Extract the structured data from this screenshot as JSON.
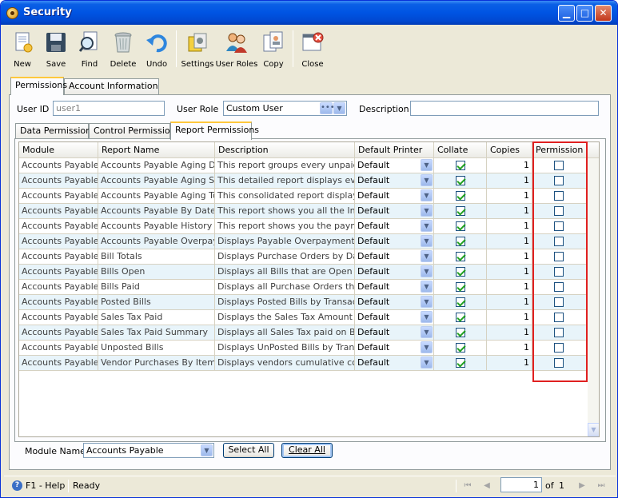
{
  "window": {
    "title": "Security"
  },
  "toolbar": {
    "items": [
      {
        "label": "New",
        "icon": "new-icon"
      },
      {
        "label": "Save",
        "icon": "save-icon"
      },
      {
        "label": "Find",
        "icon": "find-icon"
      },
      {
        "label": "Delete",
        "icon": "delete-icon"
      },
      {
        "label": "Undo",
        "icon": "undo-icon"
      },
      {
        "label": "Settings",
        "icon": "settings-icon"
      },
      {
        "label": "User Roles",
        "icon": "user-roles-icon"
      },
      {
        "label": "Copy",
        "icon": "copy-icon"
      },
      {
        "label": "Close",
        "icon": "close-icon"
      }
    ]
  },
  "outer_tabs": [
    {
      "label": "Permissions"
    },
    {
      "label": "Account Information"
    }
  ],
  "form": {
    "user_id_label": "User ID",
    "user_id_value": "user1",
    "user_role_label": "User Role",
    "user_role_value": "Custom User",
    "description_label": "Description",
    "description_value": ""
  },
  "inner_tabs": [
    {
      "label": "Data Permissions"
    },
    {
      "label": "Control Permissions"
    },
    {
      "label": "Report Permissions"
    }
  ],
  "grid": {
    "columns": [
      "Module",
      "Report Name",
      "Description",
      "Default Printer",
      "Collate",
      "Copies",
      "Permission"
    ],
    "rows": [
      {
        "module": "Accounts Payable",
        "report": "Accounts Payable Aging Deta",
        "description": "This report groups every unpaid inv",
        "printer": "Default",
        "collate": true,
        "copies": "1",
        "permission": false
      },
      {
        "module": "Accounts Payable",
        "report": "Accounts Payable Aging Sumr",
        "description": "This detailed report displays every i",
        "printer": "Default",
        "collate": true,
        "copies": "1",
        "permission": false
      },
      {
        "module": "Accounts Payable",
        "report": "Accounts Payable Aging Total",
        "description": "This consolidated report displays th",
        "printer": "Default",
        "collate": true,
        "copies": "1",
        "permission": false
      },
      {
        "module": "Accounts Payable",
        "report": "Accounts Payable By Date",
        "description": "This report shows you all the Invoic",
        "printer": "Default",
        "collate": true,
        "copies": "1",
        "permission": false
      },
      {
        "module": "Accounts Payable",
        "report": "Accounts Payable History",
        "description": "This report shows you the payment",
        "printer": "Default",
        "collate": true,
        "copies": "1",
        "permission": false
      },
      {
        "module": "Accounts Payable",
        "report": "Accounts Payable Overpayme",
        "description": "Displays Payable Overpayments for",
        "printer": "Default",
        "collate": true,
        "copies": "1",
        "permission": false
      },
      {
        "module": "Accounts Payable",
        "report": "Bill Totals",
        "description": "Displays Purchase Orders by Date,",
        "printer": "Default",
        "collate": true,
        "copies": "1",
        "permission": false
      },
      {
        "module": "Accounts Payable",
        "report": "Bills Open",
        "description": "Displays all Bills that are Open - whi",
        "printer": "Default",
        "collate": true,
        "copies": "1",
        "permission": false
      },
      {
        "module": "Accounts Payable",
        "report": "Bills Paid",
        "description": "Displays all Purchase Orders that yo",
        "printer": "Default",
        "collate": true,
        "copies": "1",
        "permission": false
      },
      {
        "module": "Accounts Payable",
        "report": "Posted Bills",
        "description": "Displays Posted Bills by Transaction",
        "printer": "Default",
        "collate": true,
        "copies": "1",
        "permission": false
      },
      {
        "module": "Accounts Payable",
        "report": "Sales Tax Paid",
        "description": "Displays the Sales Tax Amount Paid",
        "printer": "Default",
        "collate": true,
        "copies": "1",
        "permission": false
      },
      {
        "module": "Accounts Payable",
        "report": "Sales Tax Paid Summary",
        "description": "Displays all Sales Tax paid on Bills ai",
        "printer": "Default",
        "collate": true,
        "copies": "1",
        "permission": false
      },
      {
        "module": "Accounts Payable",
        "report": "Unposted Bills",
        "description": "Displays UnPosted Bills by Transacti",
        "printer": "Default",
        "collate": true,
        "copies": "1",
        "permission": false
      },
      {
        "module": "Accounts Payable",
        "report": "Vendor Purchases By Item No",
        "description": "Displays vendors cumulative cost fc",
        "printer": "Default",
        "collate": true,
        "copies": "1",
        "permission": false
      }
    ]
  },
  "footer": {
    "module_name_label": "Module Name",
    "module_name_value": "Accounts Payable",
    "select_all_label": "Select All",
    "clear_all_label": "Clear All"
  },
  "status": {
    "help_label": "F1 - Help",
    "status_text": "Ready",
    "page_current": "1",
    "page_of_label": "of",
    "page_total": "1"
  },
  "colors": {
    "titlebar": "#0054E3",
    "highlight_border": "#E02020",
    "checkmark": "#21A121",
    "row_alt": "#E8F4FA"
  }
}
